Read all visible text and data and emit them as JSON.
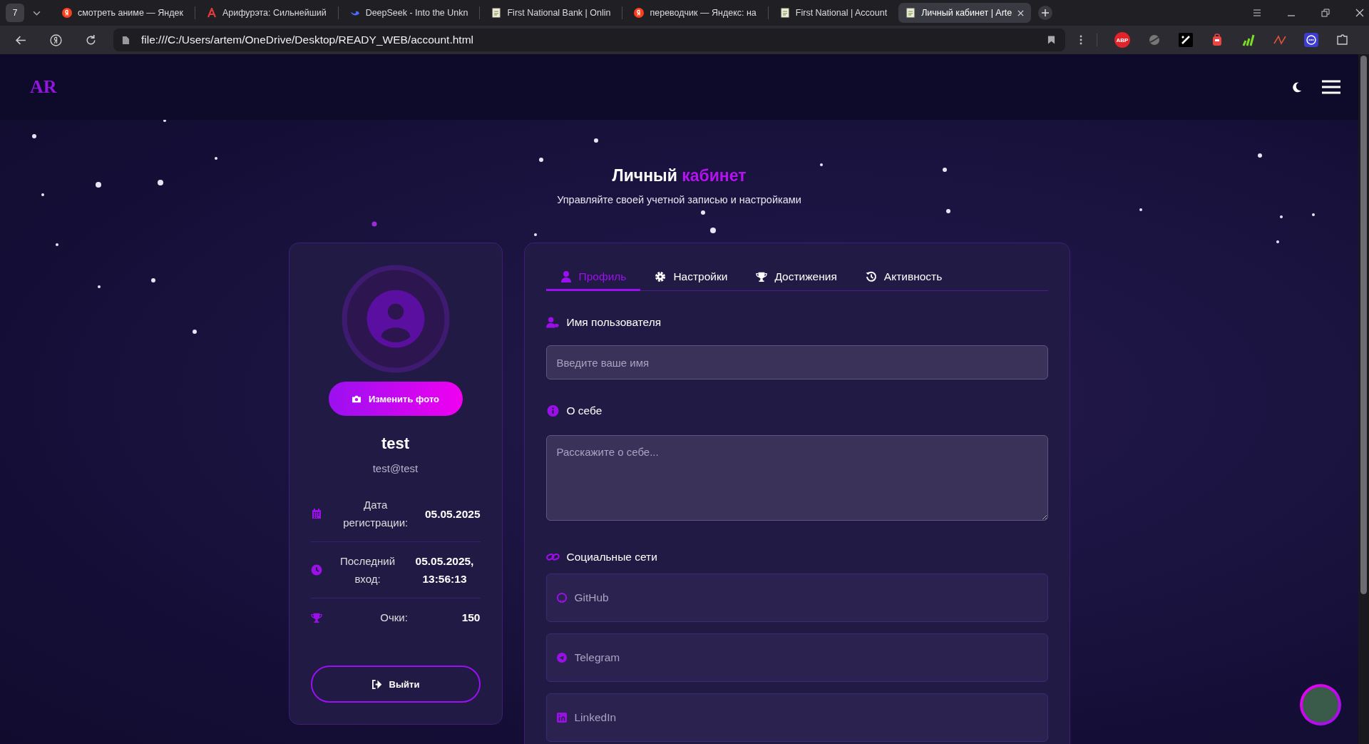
{
  "browser": {
    "tab_count": "7",
    "tabs": [
      {
        "title": "смотреть аниме — Яндек",
        "kind": "yandex",
        "selected": false
      },
      {
        "title": "Арифурэта: Сильнейший",
        "kind": "letter",
        "selected": false
      },
      {
        "title": "DeepSeek - Into the Unkn",
        "kind": "whale",
        "selected": false
      },
      {
        "title": "First National Bank | Onlin",
        "kind": "page",
        "selected": false
      },
      {
        "title": "переводчик — Яндекс: на",
        "kind": "yandex",
        "selected": false
      },
      {
        "title": "First National | Account",
        "kind": "page",
        "selected": false
      },
      {
        "title": "Личный кабинет | Arte",
        "kind": "page",
        "selected": true
      }
    ],
    "address": "file:///C:/Users/artem/OneDrive/Desktop/READY_WEB/account.html",
    "extensions": [
      {
        "kind": "abp",
        "label": "ABP"
      },
      {
        "kind": "globe"
      },
      {
        "kind": "slash"
      },
      {
        "kind": "backpack"
      },
      {
        "kind": "bars"
      },
      {
        "kind": "wave"
      },
      {
        "kind": "chat"
      },
      {
        "kind": "puzzle"
      }
    ]
  },
  "header": {
    "logo": "AR"
  },
  "hero": {
    "title": "Личный",
    "title_accent": "кабинет",
    "subtitle": "Управляйте своей учетной записью и настройками"
  },
  "profile": {
    "change_photo": "Изменить фото",
    "name": "test",
    "email": "test@test",
    "stats": [
      {
        "kind": "calendar",
        "label": "Дата регистрации:",
        "value": "05.05.2025"
      },
      {
        "kind": "clock",
        "label": "Последний вход:",
        "value": "05.05.2025, 13:56:13"
      },
      {
        "kind": "trophy",
        "label": "Очки:",
        "value": "150"
      }
    ],
    "logout": "Выйти"
  },
  "tabs": [
    {
      "kind": "user",
      "label": "Профиль",
      "selected": true
    },
    {
      "kind": "gear",
      "label": "Настройки",
      "selected": false
    },
    {
      "kind": "trophy",
      "label": "Достижения",
      "selected": false
    },
    {
      "kind": "history",
      "label": "Активность",
      "selected": false
    }
  ],
  "form": {
    "username": {
      "label": "Имя пользователя",
      "placeholder": "Введите ваше имя"
    },
    "about": {
      "label": "О себе",
      "placeholder": "Расскажите о себе..."
    },
    "social": {
      "label": "Социальные сети",
      "fields": [
        {
          "kind": "github",
          "placeholder": "GitHub"
        },
        {
          "kind": "telegram",
          "placeholder": "Telegram"
        },
        {
          "kind": "linkedin",
          "placeholder": "LinkedIn"
        }
      ]
    }
  }
}
